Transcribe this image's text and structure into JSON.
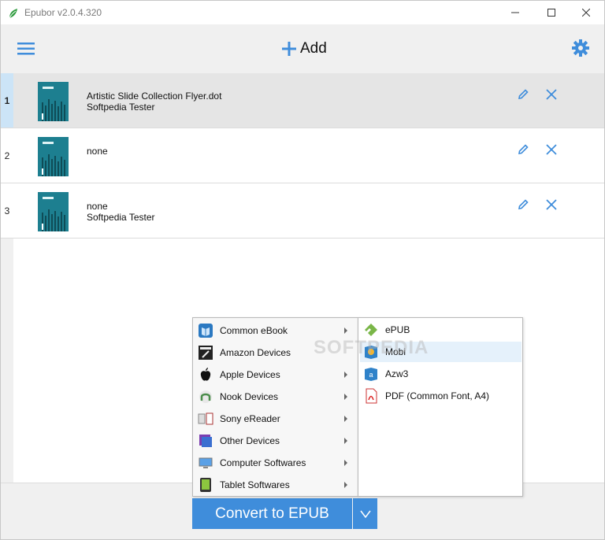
{
  "window": {
    "title": "Epubor v2.0.4.320"
  },
  "toolbar": {
    "add_label": "Add"
  },
  "books": [
    {
      "number": "1",
      "title": "Artistic Slide Collection Flyer.dot",
      "author": "Softpedia Tester",
      "selected": true
    },
    {
      "number": "2",
      "title": "none",
      "author": "",
      "selected": false
    },
    {
      "number": "3",
      "title": "none",
      "author": "Softpedia Tester",
      "selected": false
    }
  ],
  "menu": {
    "categories": [
      {
        "label": "Common eBook",
        "icon": "common-ebook-icon"
      },
      {
        "label": "Amazon Devices",
        "icon": "amazon-icon"
      },
      {
        "label": "Apple Devices",
        "icon": "apple-icon"
      },
      {
        "label": "Nook Devices",
        "icon": "nook-icon"
      },
      {
        "label": "Sony eReader",
        "icon": "sony-icon"
      },
      {
        "label": "Other Devices",
        "icon": "other-devices-icon"
      },
      {
        "label": "Computer Softwares",
        "icon": "computer-icon"
      },
      {
        "label": "Tablet Softwares",
        "icon": "tablet-icon"
      }
    ],
    "formats": [
      {
        "label": "ePUB",
        "icon": "epub-icon"
      },
      {
        "label": "Mobi",
        "icon": "mobi-icon"
      },
      {
        "label": "Azw3",
        "icon": "azw3-icon"
      },
      {
        "label": "PDF (Common Font, A4)",
        "icon": "pdf-icon"
      }
    ]
  },
  "convert": {
    "label": "Convert to EPUB"
  },
  "watermark": "SOFTPEDIA",
  "colors": {
    "accent": "#3f8ddb",
    "selected_row": "#e5e5e5",
    "row_number_selected": "#cce4f7"
  }
}
